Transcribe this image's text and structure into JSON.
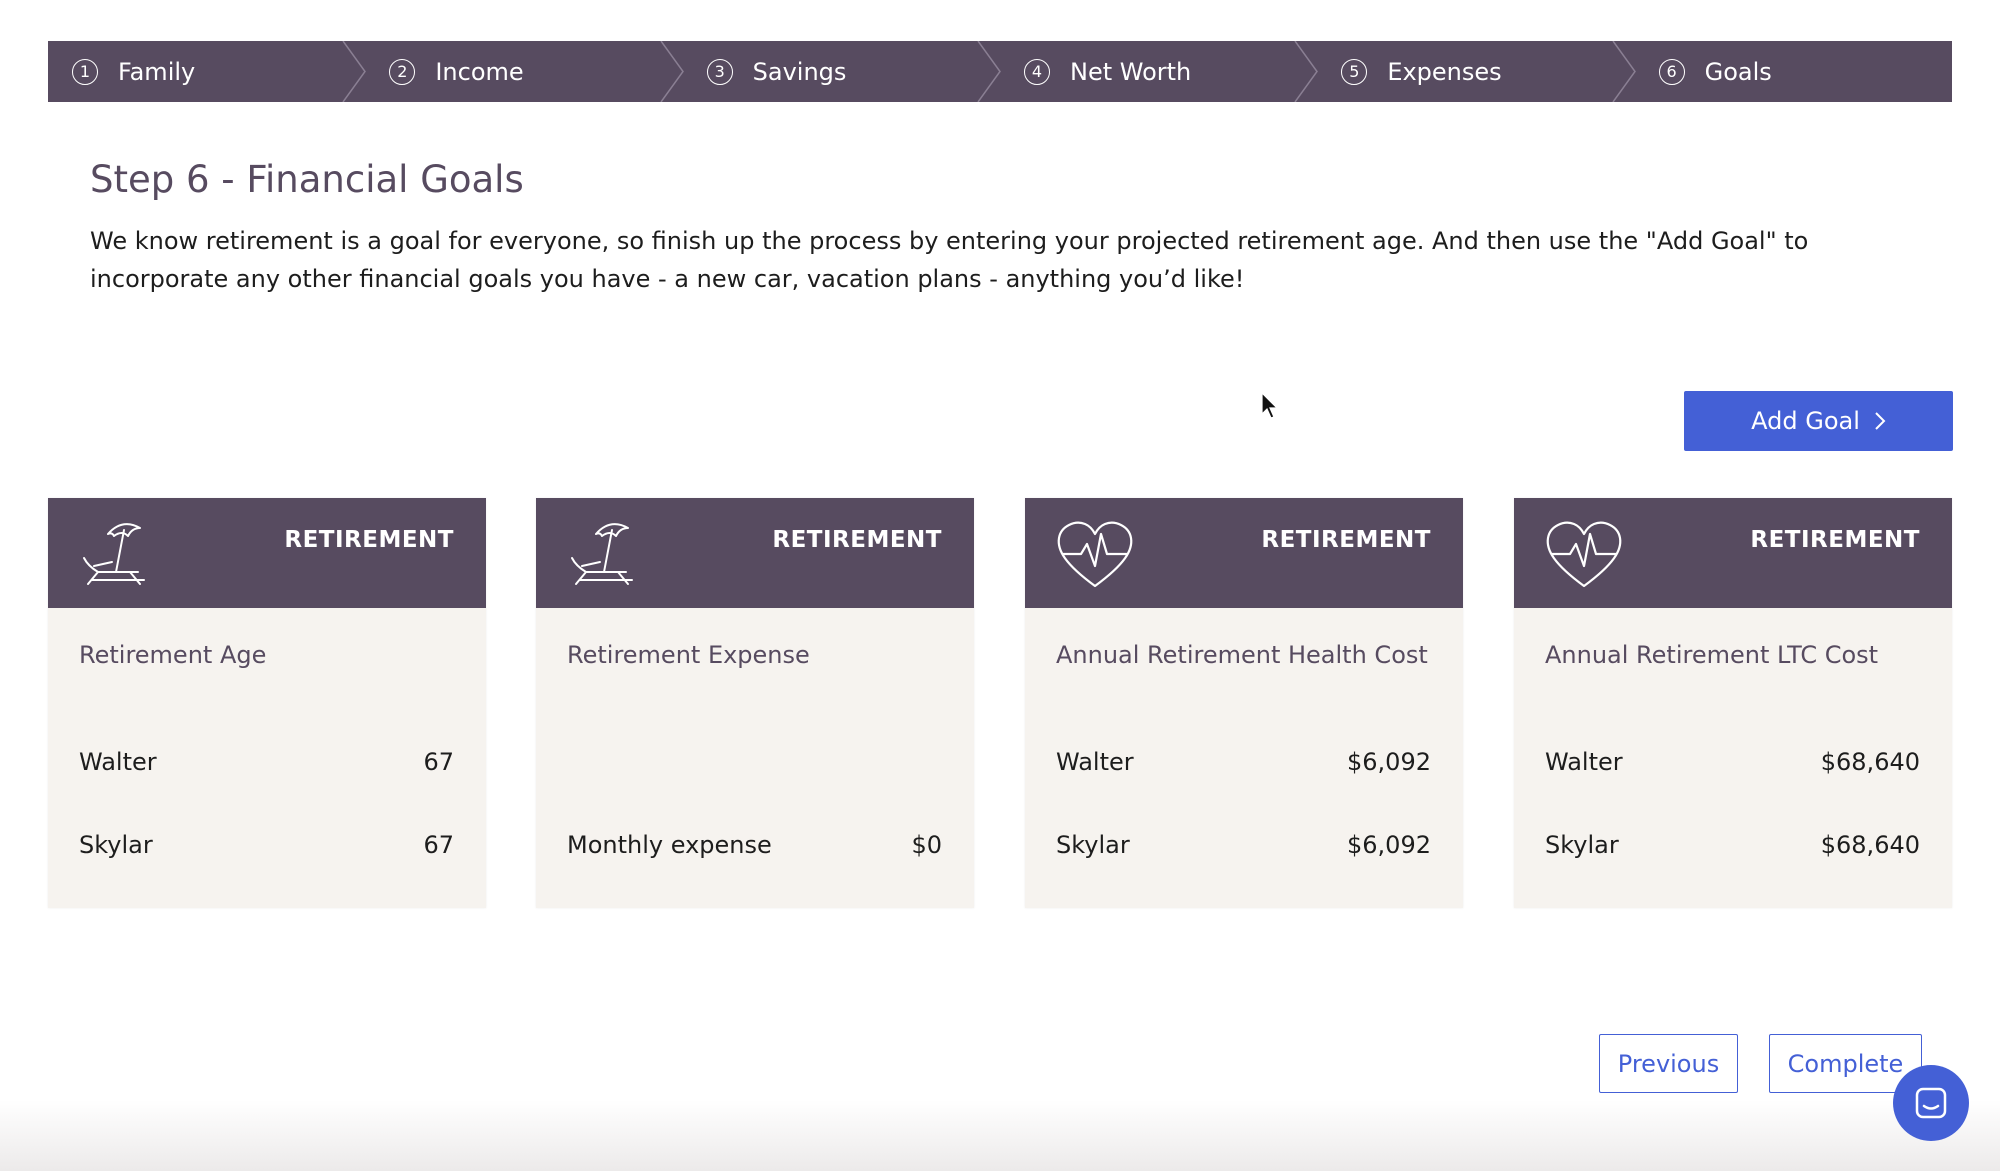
{
  "stepper": {
    "steps": [
      {
        "num": "1",
        "label": "Family"
      },
      {
        "num": "2",
        "label": "Income"
      },
      {
        "num": "3",
        "label": "Savings"
      },
      {
        "num": "4",
        "label": "Net Worth"
      },
      {
        "num": "5",
        "label": "Expenses"
      },
      {
        "num": "6",
        "label": "Goals"
      }
    ]
  },
  "page": {
    "title": "Step 6 - Financial Goals",
    "description": "We know retirement is a goal for everyone, so finish up the process by entering your projected retirement age. And then use the \"Add Goal\" to incorporate any other financial goals you have - a new car, vacation plans - anything you’d like!"
  },
  "actions": {
    "add_goal_label": "Add Goal",
    "previous_label": "Previous",
    "complete_label": "Complete"
  },
  "cards": [
    {
      "category": "RETIREMENT",
      "icon": "beach-chair-icon",
      "name": "Retirement Age",
      "rows": [
        {
          "label": "Walter",
          "value": "67"
        },
        {
          "label": "Skylar",
          "value": "67"
        }
      ]
    },
    {
      "category": "RETIREMENT",
      "icon": "beach-chair-icon",
      "name": "Retirement Expense",
      "rows": [
        {
          "label": "",
          "value": ""
        },
        {
          "label": "Monthly expense",
          "value": "$0"
        }
      ]
    },
    {
      "category": "RETIREMENT",
      "icon": "heart-pulse-icon",
      "name": "Annual Retirement Health Cost",
      "rows": [
        {
          "label": "Walter",
          "value": "$6,092"
        },
        {
          "label": "Skylar",
          "value": "$6,092"
        }
      ]
    },
    {
      "category": "RETIREMENT",
      "icon": "heart-pulse-icon",
      "name": "Annual Retirement LTC Cost",
      "rows": [
        {
          "label": "Walter",
          "value": "$68,640"
        },
        {
          "label": "Skylar",
          "value": "$68,640"
        }
      ]
    }
  ],
  "colors": {
    "header_purple": "#574b60",
    "accent_blue": "#4460d6",
    "card_bg": "#f6f3ef"
  }
}
